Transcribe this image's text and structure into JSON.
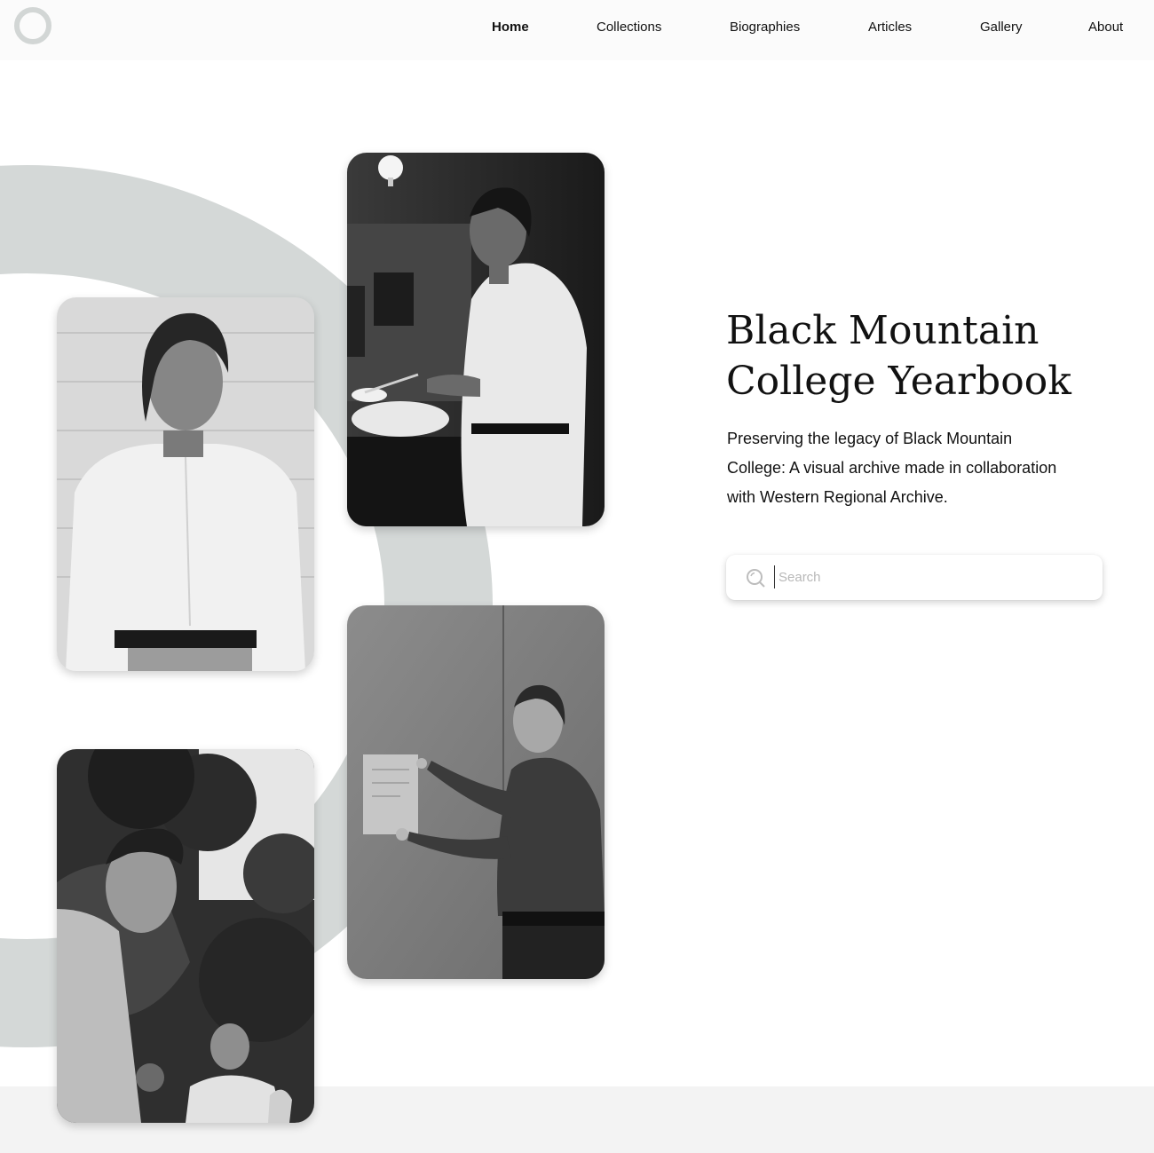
{
  "header": {
    "logo_icon": "ring-logo-icon",
    "nav": [
      {
        "label": "Home",
        "active": true
      },
      {
        "label": "Collections",
        "active": false
      },
      {
        "label": "Biographies",
        "active": false
      },
      {
        "label": "Articles",
        "active": false
      },
      {
        "label": "Gallery",
        "active": false
      },
      {
        "label": "About",
        "active": false
      }
    ]
  },
  "hero": {
    "title": "Black Mountain College Yearbook",
    "subtitle": "Preserving the legacy of Black Mountain College: A visual archive made in collaboration with Western Regional Archive.",
    "search": {
      "placeholder": "Search",
      "value": "",
      "icon": "search-icon"
    }
  },
  "gallery": {
    "photos": [
      {
        "name": "photo-woman-in-kitchen"
      },
      {
        "name": "photo-woman-portrait"
      },
      {
        "name": "photo-man-at-wall"
      },
      {
        "name": "photo-young-man-outdoors"
      }
    ]
  },
  "colors": {
    "ring": "#d4d8d7",
    "header_bg": "#fbfbfb",
    "footer_bg": "#f3f3f3",
    "text": "#111111"
  }
}
